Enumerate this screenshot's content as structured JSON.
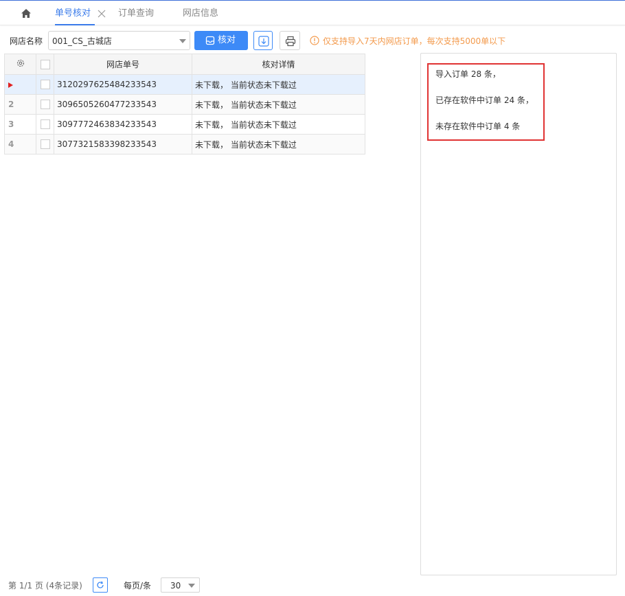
{
  "tabs": [
    {
      "label": "单号核对",
      "active": true
    },
    {
      "label": "订单查询",
      "active": false
    },
    {
      "label": "网店信息",
      "active": false
    }
  ],
  "toolbar": {
    "shop_label": "网店名称",
    "shop_value": "001_CS_古城店",
    "check_label": "核对",
    "notice": "仅支持导入7天内网店订单，每次支持5000单以下"
  },
  "grid": {
    "columns": [
      "网店单号",
      "核对详情"
    ],
    "rows": [
      {
        "no": "",
        "order": "3120297625484233543",
        "detail": "未下载，  当前状态未下载过"
      },
      {
        "no": "2",
        "order": "3096505260477233543",
        "detail": "未下载，  当前状态未下载过"
      },
      {
        "no": "3",
        "order": "3097772463834233543",
        "detail": "未下载，  当前状态未下载过"
      },
      {
        "no": "4",
        "order": "3077321583398233543",
        "detail": "未下载，  当前状态未下载过"
      }
    ]
  },
  "result": {
    "imported": "导入订单 28 条，",
    "existing": "已存在软件中订单 24 条，",
    "missing": "未存在软件中订单 4 条"
  },
  "pager": {
    "info": "第 1/1 页 (4条记录)",
    "page_size_label": "每页/条",
    "page_size": "30"
  },
  "colors": {
    "accent": "#3d8af7",
    "notice": "#f39a4c",
    "highlight_border": "#e03232"
  }
}
